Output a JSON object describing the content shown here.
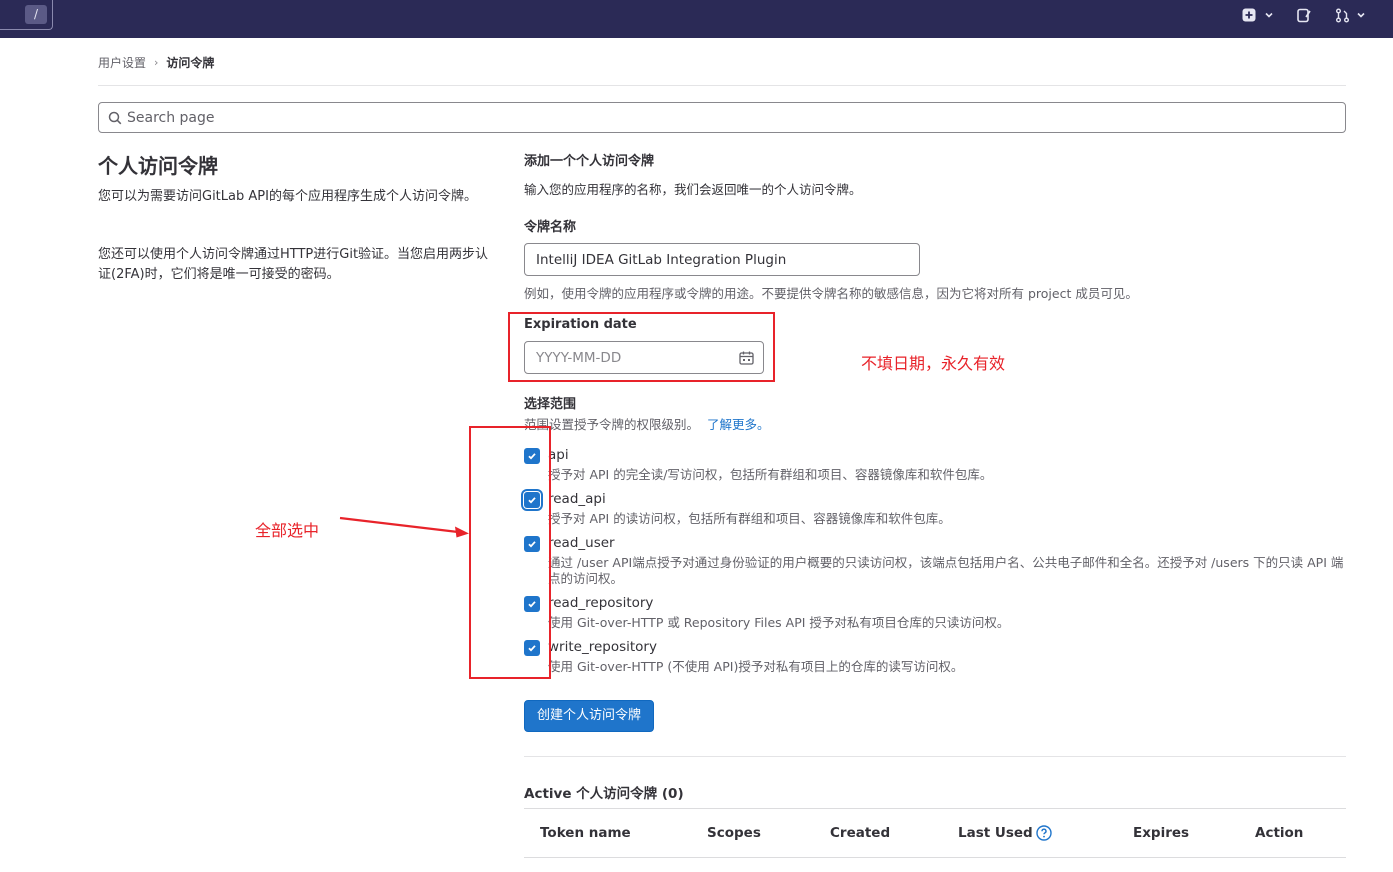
{
  "topbar": {
    "slash_key": "/",
    "icons": [
      "plus-icon",
      "chevron-down-icon",
      "issues-icon",
      "merge-request-icon",
      "chevron-down-icon"
    ]
  },
  "breadcrumb": {
    "parent": "用户设置",
    "current": "访问令牌"
  },
  "search": {
    "placeholder": "Search page"
  },
  "left": {
    "title": "个人访问令牌",
    "para1": "您可以为需要访问GitLab API的每个应用程序生成个人访问令牌。",
    "para2": "您还可以使用个人访问令牌通过HTTP进行Git验证。当您启用两步认证(2FA)时，它们将是唯一可接受的密码。"
  },
  "form": {
    "section_title": "添加一个个人访问令牌",
    "section_desc": "输入您的应用程序的名称，我们会返回唯一的个人访问令牌。",
    "name_label": "令牌名称",
    "name_value": "IntelliJ IDEA GitLab Integration Plugin",
    "name_help": "例如，使用令牌的应用程序或令牌的用途。不要提供令牌名称的敏感信息，因为它将对所有 project 成员可见。",
    "expiration_label": "Expiration date",
    "expiration_placeholder": "YYYY-MM-DD",
    "scope_label": "选择范围",
    "scope_desc": "范围设置授予令牌的权限级别。",
    "scope_link": "了解更多。",
    "scopes": [
      {
        "name": "api",
        "checked": true,
        "help": "授予对 API 的完全读/写访问权，包括所有群组和项目、容器镜像库和软件包库。"
      },
      {
        "name": "read_api",
        "checked": true,
        "help": "授予对 API 的读访问权，包括所有群组和项目、容器镜像库和软件包库。"
      },
      {
        "name": "read_user",
        "checked": true,
        "help": "通过 /user API端点授予对通过身份验证的用户概要的只读访问权，该端点包括用户名、公共电子邮件和全名。还授予对 /users 下的只读 API 端点的访问权。"
      },
      {
        "name": "read_repository",
        "checked": true,
        "help": "使用 Git-over-HTTP 或 Repository Files API 授予对私有项目仓库的只读访问权。"
      },
      {
        "name": "write_repository",
        "checked": true,
        "help": "使用 Git-over-HTTP (不使用 API)授予对私有项目上的仓库的读写访问权。"
      }
    ],
    "create_button": "创建个人访问令牌"
  },
  "active_tokens": {
    "title": "Active 个人访问令牌 (0)",
    "columns": [
      "Token name",
      "Scopes",
      "Created",
      "Last Used",
      "Expires",
      "Action"
    ]
  },
  "annotations": {
    "expiration_note": "不填日期，永久有效",
    "select_all_note": "全部选中",
    "color": "#e8232a"
  },
  "colors": {
    "topbar": "#2b2a56",
    "primary": "#1f75cb"
  }
}
